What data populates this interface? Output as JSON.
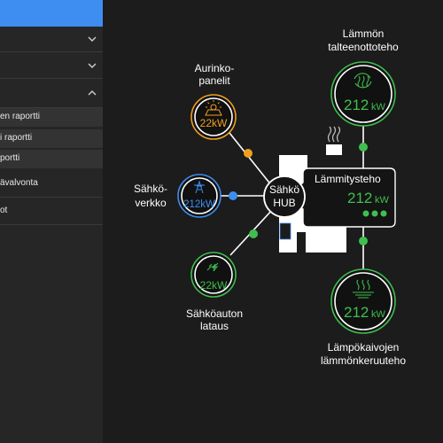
{
  "sidebar": {
    "items": [
      {
        "label": "en raportti"
      },
      {
        "label": "i raportti"
      },
      {
        "label": "portti"
      },
      {
        "label": "ävalvonta"
      },
      {
        "label": "ot"
      }
    ]
  },
  "diagram": {
    "hub": {
      "line1": "Sähkö",
      "line2": "HUB"
    },
    "solar": {
      "label1": "Aurinko-",
      "label2": "panelit",
      "value": "22kW",
      "color": "#f0a020"
    },
    "grid": {
      "label1": "Sähkö-",
      "label2": "verkko",
      "value": "212kW",
      "color": "#3d8ef0"
    },
    "ev": {
      "label1": "Sähköauton",
      "label2": "lataus",
      "value": "22kW",
      "color": "#3fbf4f"
    },
    "heat_recovery": {
      "label1": "Lämmön",
      "label2": "talteenottoteho",
      "value": "212",
      "unit": "kW",
      "color": "#3fbf4f"
    },
    "heating_power": {
      "title": "Lämmitysteho",
      "value": "212",
      "unit": "kW"
    },
    "collector": {
      "label1": "Lämpökaivojen",
      "label2": "lämmönkeruuteho",
      "value": "212",
      "unit": "kW",
      "color": "#3fbf4f"
    }
  }
}
